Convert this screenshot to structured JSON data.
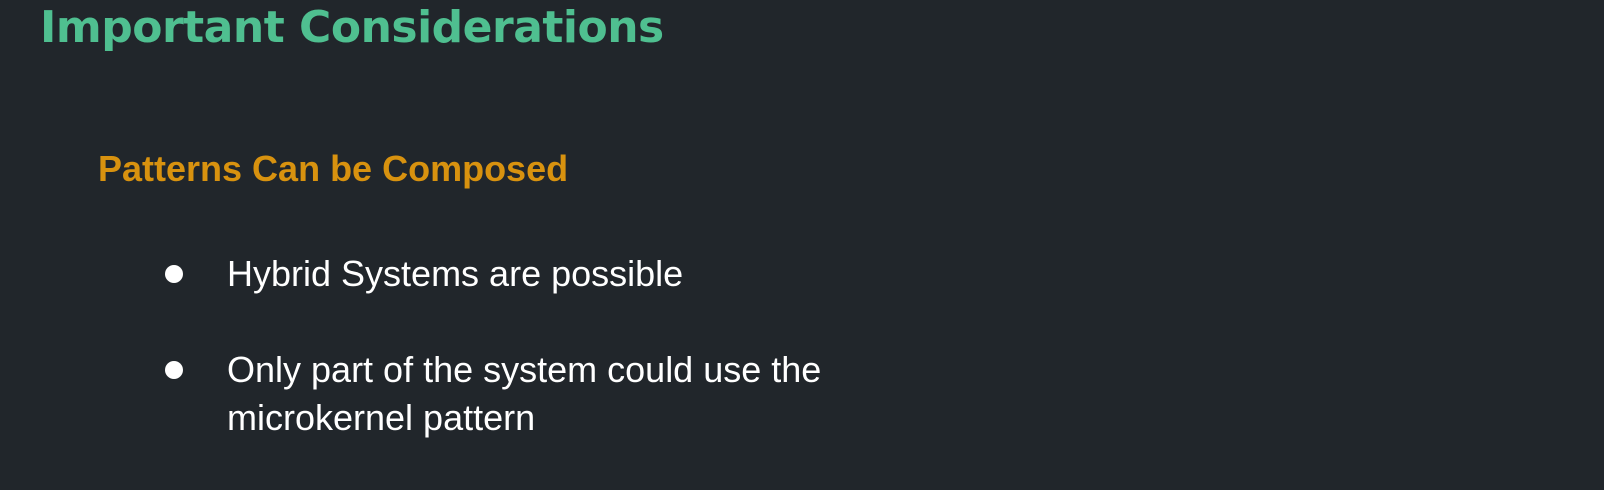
{
  "slide": {
    "title": "Important Considerations",
    "subtitle": "Patterns Can be Composed",
    "bullets": [
      "Hybrid Systems are possible",
      "Only part of the system could use the microkernel pattern"
    ]
  },
  "colors": {
    "background": "#21262b",
    "title": "#4fbf90",
    "subtitle": "#d8920f",
    "body_text": "#ffffff"
  },
  "icons": {
    "bullet": "filled-circle"
  }
}
